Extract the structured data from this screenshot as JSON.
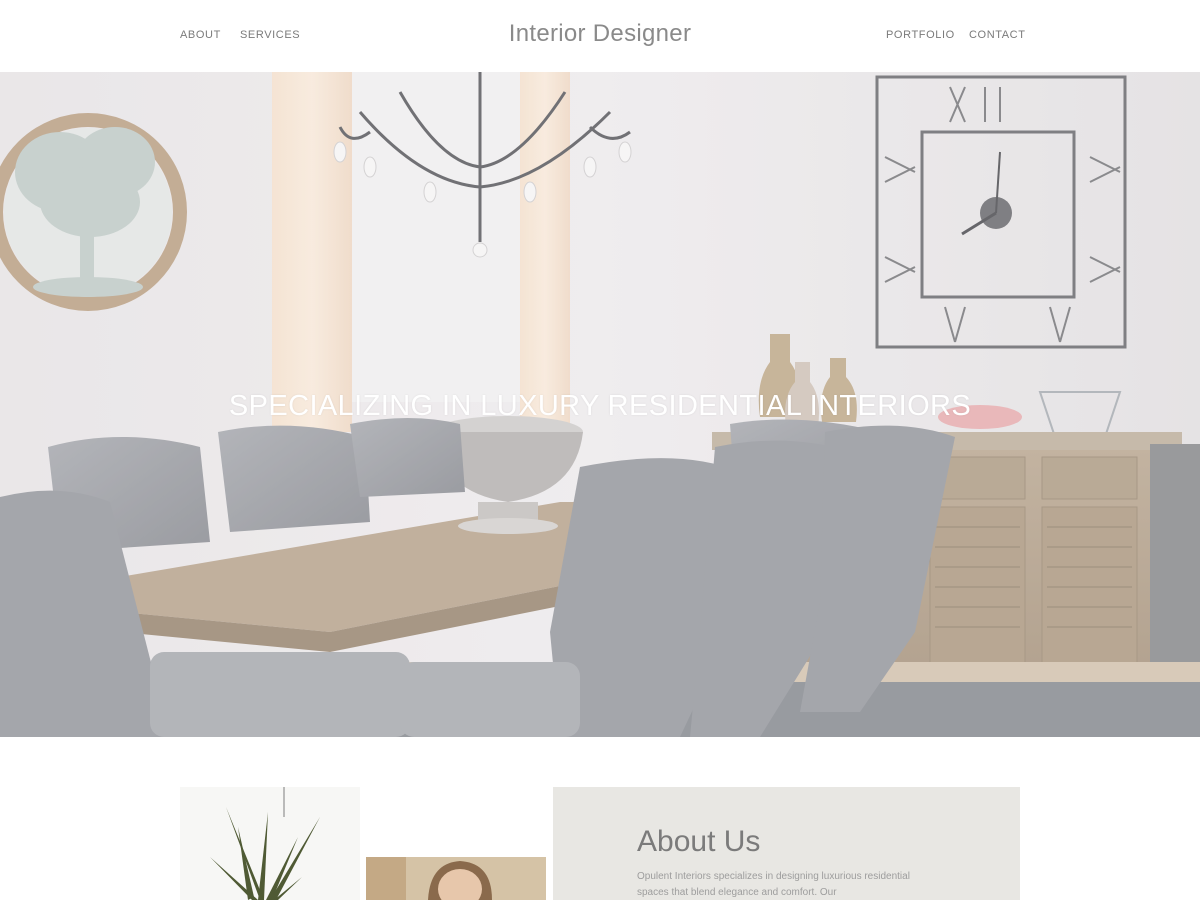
{
  "header": {
    "brand": "Interior Designer",
    "nav_left": [
      "ABOUT",
      "SERVICES"
    ],
    "nav_right": [
      "PORTFOLIO",
      "CONTACT"
    ]
  },
  "hero": {
    "tagline": "SPECIALIZING IN LUXURY RESIDENTIAL INTERIORS",
    "image": "dining-room-photo"
  },
  "about": {
    "title": "About Us",
    "body": "Opulent Interiors specializes in designing luxurious residential spaces that blend elegance and comfort. Our",
    "images": [
      "plant-photo",
      "portrait-photo"
    ]
  },
  "colors": {
    "header_bg": "#ffffff",
    "nav_text": "#7a7a7a",
    "hero_text": "#ffffff",
    "about_panel_bg": "#e8e7e3"
  }
}
